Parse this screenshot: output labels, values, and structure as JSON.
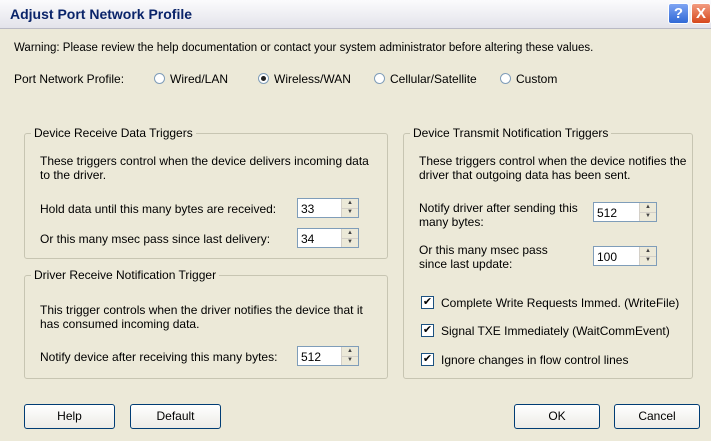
{
  "window": {
    "title": "Adjust Port Network Profile",
    "help_glyph": "?",
    "close_glyph": "X"
  },
  "warning": "Warning:  Please review the help documentation or contact your system administrator before altering these values.",
  "profile": {
    "label": "Port Network Profile:",
    "options": [
      "Wired/LAN",
      "Wireless/WAN",
      "Cellular/Satellite",
      "Custom"
    ],
    "selected": "Wireless/WAN"
  },
  "receive_data": {
    "title": "Device Receive Data Triggers",
    "description": "These triggers control when the device delivers incoming data to the driver.",
    "hold_label": "Hold data until this many bytes are received:",
    "hold_value": "33",
    "msec_label": "Or this many msec pass since last delivery:",
    "msec_value": "34"
  },
  "receive_notify": {
    "title": "Driver Receive Notification Trigger",
    "description": "This trigger controls when the driver notifies the device that it has consumed incoming data.",
    "notify_label": "Notify device after receiving this many bytes:",
    "notify_value": "512"
  },
  "transmit": {
    "title": "Device Transmit Notification Triggers",
    "description": "These triggers control when the device notifies the driver that outgoing data has been sent.",
    "bytes_label": "Notify driver after sending this many bytes:",
    "bytes_value": "512",
    "msec_label": "Or this many msec pass since last update:",
    "msec_value": "100",
    "checks": [
      {
        "label": "Complete Write Requests Immed. (WriteFile)",
        "checked": true
      },
      {
        "label": "Signal TXE Immediately (WaitCommEvent)",
        "checked": true
      },
      {
        "label": "Ignore changes in flow control lines",
        "checked": true
      }
    ],
    "check_mark": "✔"
  },
  "buttons": {
    "help": "Help",
    "default": "Default",
    "ok": "OK",
    "cancel": "Cancel"
  },
  "spin": {
    "up": "▲",
    "down": "▼"
  }
}
